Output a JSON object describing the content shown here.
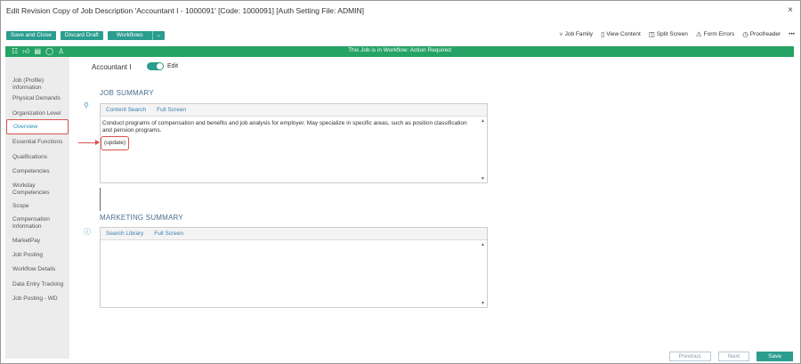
{
  "window": {
    "title": "Edit Revision Copy of Job Description 'Accountant I - 1000091' [Code: 1000091] [Auth Setting File: ADMIN]",
    "close": "×"
  },
  "toolbar": {
    "save_close": "Save and Close",
    "discard_draft": "Discard Draft",
    "workflows": "Workflows",
    "workflows_caret": "⌄"
  },
  "tools": {
    "job_family": "Job Family",
    "view_content": "View Content",
    "split_screen": "Split Screen",
    "form_errors": "Form Errors",
    "proofreader": "Proofreader",
    "more": "•••"
  },
  "status_bar": {
    "message": "This Job is in Workflow: Action Required"
  },
  "sidebar": {
    "items": [
      "Job (Profile) Information",
      "Physical Demands",
      "Organization Level",
      "Overview",
      "Essential Functions",
      "Qualifications",
      "Competencies",
      "Workday Competencies",
      "Scope",
      "Compensation Information",
      "MarketPay",
      "Job Posting",
      "Workflow Details",
      "Data Entry Tracking",
      "Job Posting - WD"
    ],
    "active": "Overview"
  },
  "header": {
    "job_name": "Accountant I",
    "edit_label": "Edit",
    "edit_toggle_on": true
  },
  "job_summary": {
    "title": "JOB SUMMARY",
    "tab_content_search": "Content Search",
    "tab_full_screen": "Full Screen",
    "text": "Conduct programs of compensation and benefits and job analysis for employer. May specialize in specific areas, such as position classification and pension programs.",
    "update_text": "(update)"
  },
  "marketing_summary": {
    "title": "MARKETING SUMMARY",
    "tab_search_library": "Search Library",
    "tab_full_screen": "Full Screen",
    "text": ""
  },
  "footer": {
    "previous": "Previous",
    "next": "Next",
    "save": "Save"
  },
  "colors": {
    "accent": "#2a9d8f",
    "status_green": "#25a265",
    "highlight_red": "#d9534f",
    "section_blue": "#4a6d8c"
  }
}
